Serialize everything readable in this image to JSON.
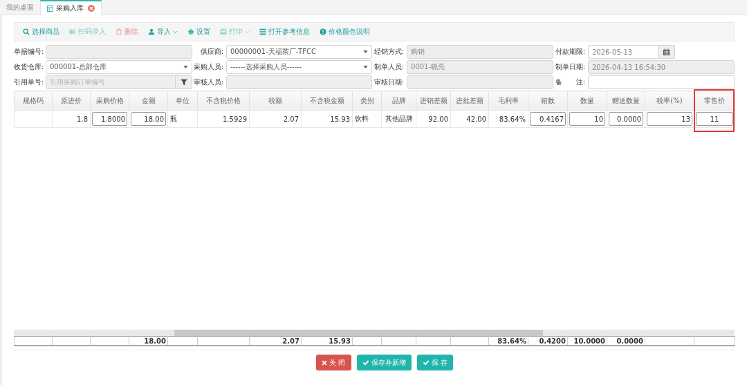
{
  "tabs": [
    {
      "label": "我的桌面",
      "selected": false,
      "closable": false
    },
    {
      "label": "采购入库",
      "selected": true,
      "closable": true
    }
  ],
  "toolbar": [
    {
      "label": "选择商品",
      "disabled": false,
      "dropdown": false
    },
    {
      "label": "扫码录入",
      "disabled": true,
      "dropdown": false
    },
    {
      "label": "删除",
      "disabled": true,
      "dropdown": false
    },
    {
      "label": "导入",
      "disabled": false,
      "dropdown": true
    },
    {
      "label": "设置",
      "disabled": false,
      "dropdown": false
    },
    {
      "label": "打印",
      "disabled": true,
      "dropdown": true
    },
    {
      "label": "打开参考信息",
      "disabled": false,
      "dropdown": false
    },
    {
      "label": "价格颜色说明",
      "disabled": false,
      "dropdown": false
    }
  ],
  "form": [
    [
      {
        "label": "单据编号:",
        "kind": "readonly"
      },
      {
        "label": "供应商:",
        "kind": "select",
        "value": "00000001-天福茶厂-TFCC"
      },
      {
        "label": "经销方式:",
        "kind": "readonly",
        "value": "购销"
      },
      {
        "label": "付款期限:",
        "kind": "date",
        "value": "2026-05-13"
      }
    ],
    [
      {
        "label": "收货仓库:",
        "kind": "select",
        "value": "000001-总部仓库"
      },
      {
        "label": "采购人员:",
        "kind": "select",
        "value": "------选择采购人员------"
      },
      {
        "label": "制单人员:",
        "kind": "readonly",
        "value": "0001-晓亮"
      },
      {
        "label": "制单日期:",
        "kind": "readonly",
        "value": "2026-04-13 16:54:30"
      }
    ],
    [
      {
        "label": "引用单号:",
        "kind": "lookup",
        "placeholder": "引用采购订单编号"
      },
      {
        "label": "审核人员:",
        "kind": "readonly"
      },
      {
        "label": "审核日期:",
        "kind": "readonly"
      },
      {
        "label": "备　　注:",
        "kind": "text"
      }
    ]
  ],
  "table": {
    "columns": [
      {
        "label": "规格码",
        "highlighted": false
      },
      {
        "label": "原进价",
        "highlighted": false
      },
      {
        "label": "采购价格",
        "highlighted": false
      },
      {
        "label": "金额",
        "highlighted": false,
        "total": "18.00"
      },
      {
        "label": "单位",
        "highlighted": false
      },
      {
        "label": "不含税价格",
        "highlighted": false
      },
      {
        "label": "税额",
        "highlighted": false,
        "total": "2.07"
      },
      {
        "label": "不含税金额",
        "highlighted": false,
        "total": "15.93"
      },
      {
        "label": "类别",
        "highlighted": false
      },
      {
        "label": "品牌",
        "highlighted": false
      },
      {
        "label": "进销差额",
        "highlighted": false
      },
      {
        "label": "进批差额",
        "highlighted": false
      },
      {
        "label": "毛利率",
        "highlighted": false,
        "total": "83.64%"
      },
      {
        "label": "箱数",
        "highlighted": false,
        "total": "0.4200"
      },
      {
        "label": "数量",
        "highlighted": false,
        "total": "10.0000"
      },
      {
        "label": "赠送数量",
        "highlighted": false,
        "total": "0.0000"
      },
      {
        "label": "税率(%)",
        "highlighted": false
      },
      {
        "label": "零售价",
        "highlighted": true
      }
    ],
    "rows": [
      {
        "cells": [
          {
            "kind": "text"
          },
          {
            "kind": "text",
            "value": "1.8"
          },
          {
            "kind": "input",
            "value": "1.8000"
          },
          {
            "kind": "input",
            "value": "18.00"
          },
          {
            "kind": "text",
            "value": "瓶"
          },
          {
            "kind": "text",
            "value": "1.5929"
          },
          {
            "kind": "text",
            "value": "2.07"
          },
          {
            "kind": "text",
            "value": "15.93"
          },
          {
            "kind": "text",
            "value": "饮料"
          },
          {
            "kind": "text",
            "value": "其他品牌"
          },
          {
            "kind": "text",
            "value": "92.00"
          },
          {
            "kind": "text",
            "value": "42.00"
          },
          {
            "kind": "text",
            "value": "83.64%"
          },
          {
            "kind": "input",
            "value": "0.4167"
          },
          {
            "kind": "input",
            "value": "10"
          },
          {
            "kind": "input",
            "value": "0.0000"
          },
          {
            "kind": "input",
            "value": "13"
          },
          {
            "kind": "input",
            "value": "11"
          }
        ]
      }
    ]
  },
  "buttons": [
    {
      "label": "关 闭",
      "kind": "danger"
    },
    {
      "label": "保存并新增",
      "kind": "primary"
    },
    {
      "label": "保 存",
      "kind": "primary"
    }
  ]
}
